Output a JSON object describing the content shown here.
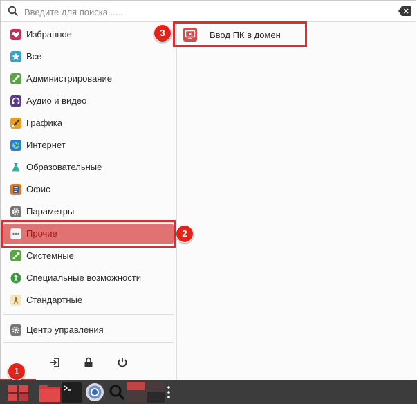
{
  "search": {
    "placeholder": "Введите для поиска......"
  },
  "categories": [
    {
      "label": "Избранное",
      "icon": "heart-icon",
      "color": "#c0305a"
    },
    {
      "label": "Все",
      "icon": "star-icon",
      "color": "#3aa0c8"
    },
    {
      "label": "Администрирование",
      "icon": "wrench-icon",
      "color": "#5ba545"
    },
    {
      "label": "Аудио и видео",
      "icon": "headphones-icon",
      "color": "#5b3a8a"
    },
    {
      "label": "Графика",
      "icon": "brush-icon",
      "color": "#e8a020"
    },
    {
      "label": "Интернет",
      "icon": "globe-icon",
      "color": "#2a7fc0"
    },
    {
      "label": "Образовательные",
      "icon": "flask-icon",
      "color": "#3ab0a0"
    },
    {
      "label": "Офис",
      "icon": "office-icon",
      "color": "#e07a20"
    },
    {
      "label": "Параметры",
      "icon": "gear-icon",
      "color": "#777777"
    },
    {
      "label": "Прочие",
      "icon": "dots-icon",
      "color": "#b0b0b0"
    },
    {
      "label": "Системные",
      "icon": "system-wrench-icon",
      "color": "#5ba545"
    },
    {
      "label": "Специальные возможности",
      "icon": "accessibility-icon",
      "color": "#3a9a3a"
    },
    {
      "label": "Стандартные",
      "icon": "pen-icon",
      "color": "#d0a040"
    }
  ],
  "control_center": {
    "label": "Центр управления",
    "icon": "gear-icon"
  },
  "power": {
    "logout_icon": "logout-icon",
    "lock_icon": "lock-icon",
    "power_icon": "power-icon"
  },
  "apps": [
    {
      "label": "Ввод ПК в домен",
      "icon": "domain-join-icon"
    }
  ],
  "badges": {
    "one": "1",
    "two": "2",
    "three": "3"
  },
  "colors": {
    "accent": "#e07372",
    "highlight": "#dd2d2f",
    "badge": "#e2231a",
    "taskbar": "#3c3c3c"
  }
}
